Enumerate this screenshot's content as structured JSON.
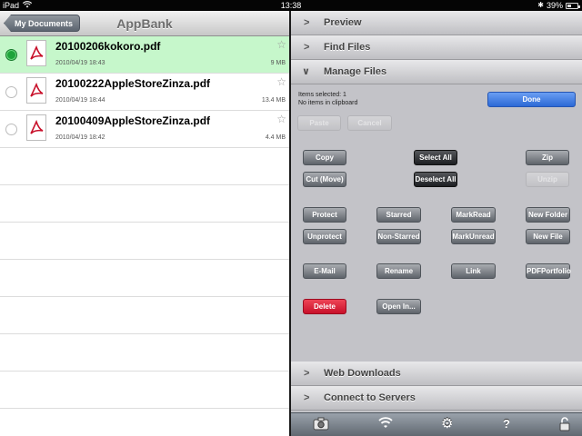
{
  "status_bar": {
    "device": "iPad",
    "time": "13:38",
    "battery": "39%",
    "battery_level": 0.39
  },
  "nav": {
    "back_label": "My Documents",
    "title": "AppBank"
  },
  "files": [
    {
      "name": "20100206kokoro.pdf",
      "date": "2010/04/19 18:43",
      "size": "9 MB",
      "selected": true
    },
    {
      "name": "20100222AppleStoreZinza.pdf",
      "date": "2010/04/19 18:44",
      "size": "13.4 MB",
      "selected": false
    },
    {
      "name": "20100409AppleStoreZinza.pdf",
      "date": "2010/04/19 18:42",
      "size": "4.4 MB",
      "selected": false
    }
  ],
  "sections": {
    "preview": "Preview",
    "find_files": "Find Files",
    "manage_files": "Manage Files",
    "web_downloads": "Web Downloads",
    "connect_servers": "Connect to Servers"
  },
  "manage": {
    "items_selected": "Items selected: 1",
    "clipboard": "No items in clipboard",
    "done": "Done",
    "paste": "Paste",
    "cancel": "Cancel",
    "copy": "Copy",
    "select_all": "Select All",
    "zip": "Zip",
    "cut_move": "Cut (Move)",
    "deselect_all": "Deselect All",
    "unzip": "Unzip",
    "protect": "Protect",
    "starred": "Starred",
    "mark_read": "MarkRead",
    "new_folder": "New Folder",
    "unprotect": "Unprotect",
    "non_starred": "Non-Starred",
    "mark_unread": "MarkUnread",
    "new_file": "New File",
    "email": "E-Mail",
    "rename": "Rename",
    "link": "Link",
    "pdf_portfolio": "PDFPortfolio",
    "delete": "Delete",
    "open_in": "Open In..."
  },
  "toolbar_icons": [
    "camera-icon",
    "wifi-icon",
    "gear-icon",
    "help-icon",
    "lock-icon"
  ],
  "colors": {
    "selected_row": "#c6f7cb",
    "done_button": "#2c69d6",
    "delete_button": "#c8102a"
  }
}
